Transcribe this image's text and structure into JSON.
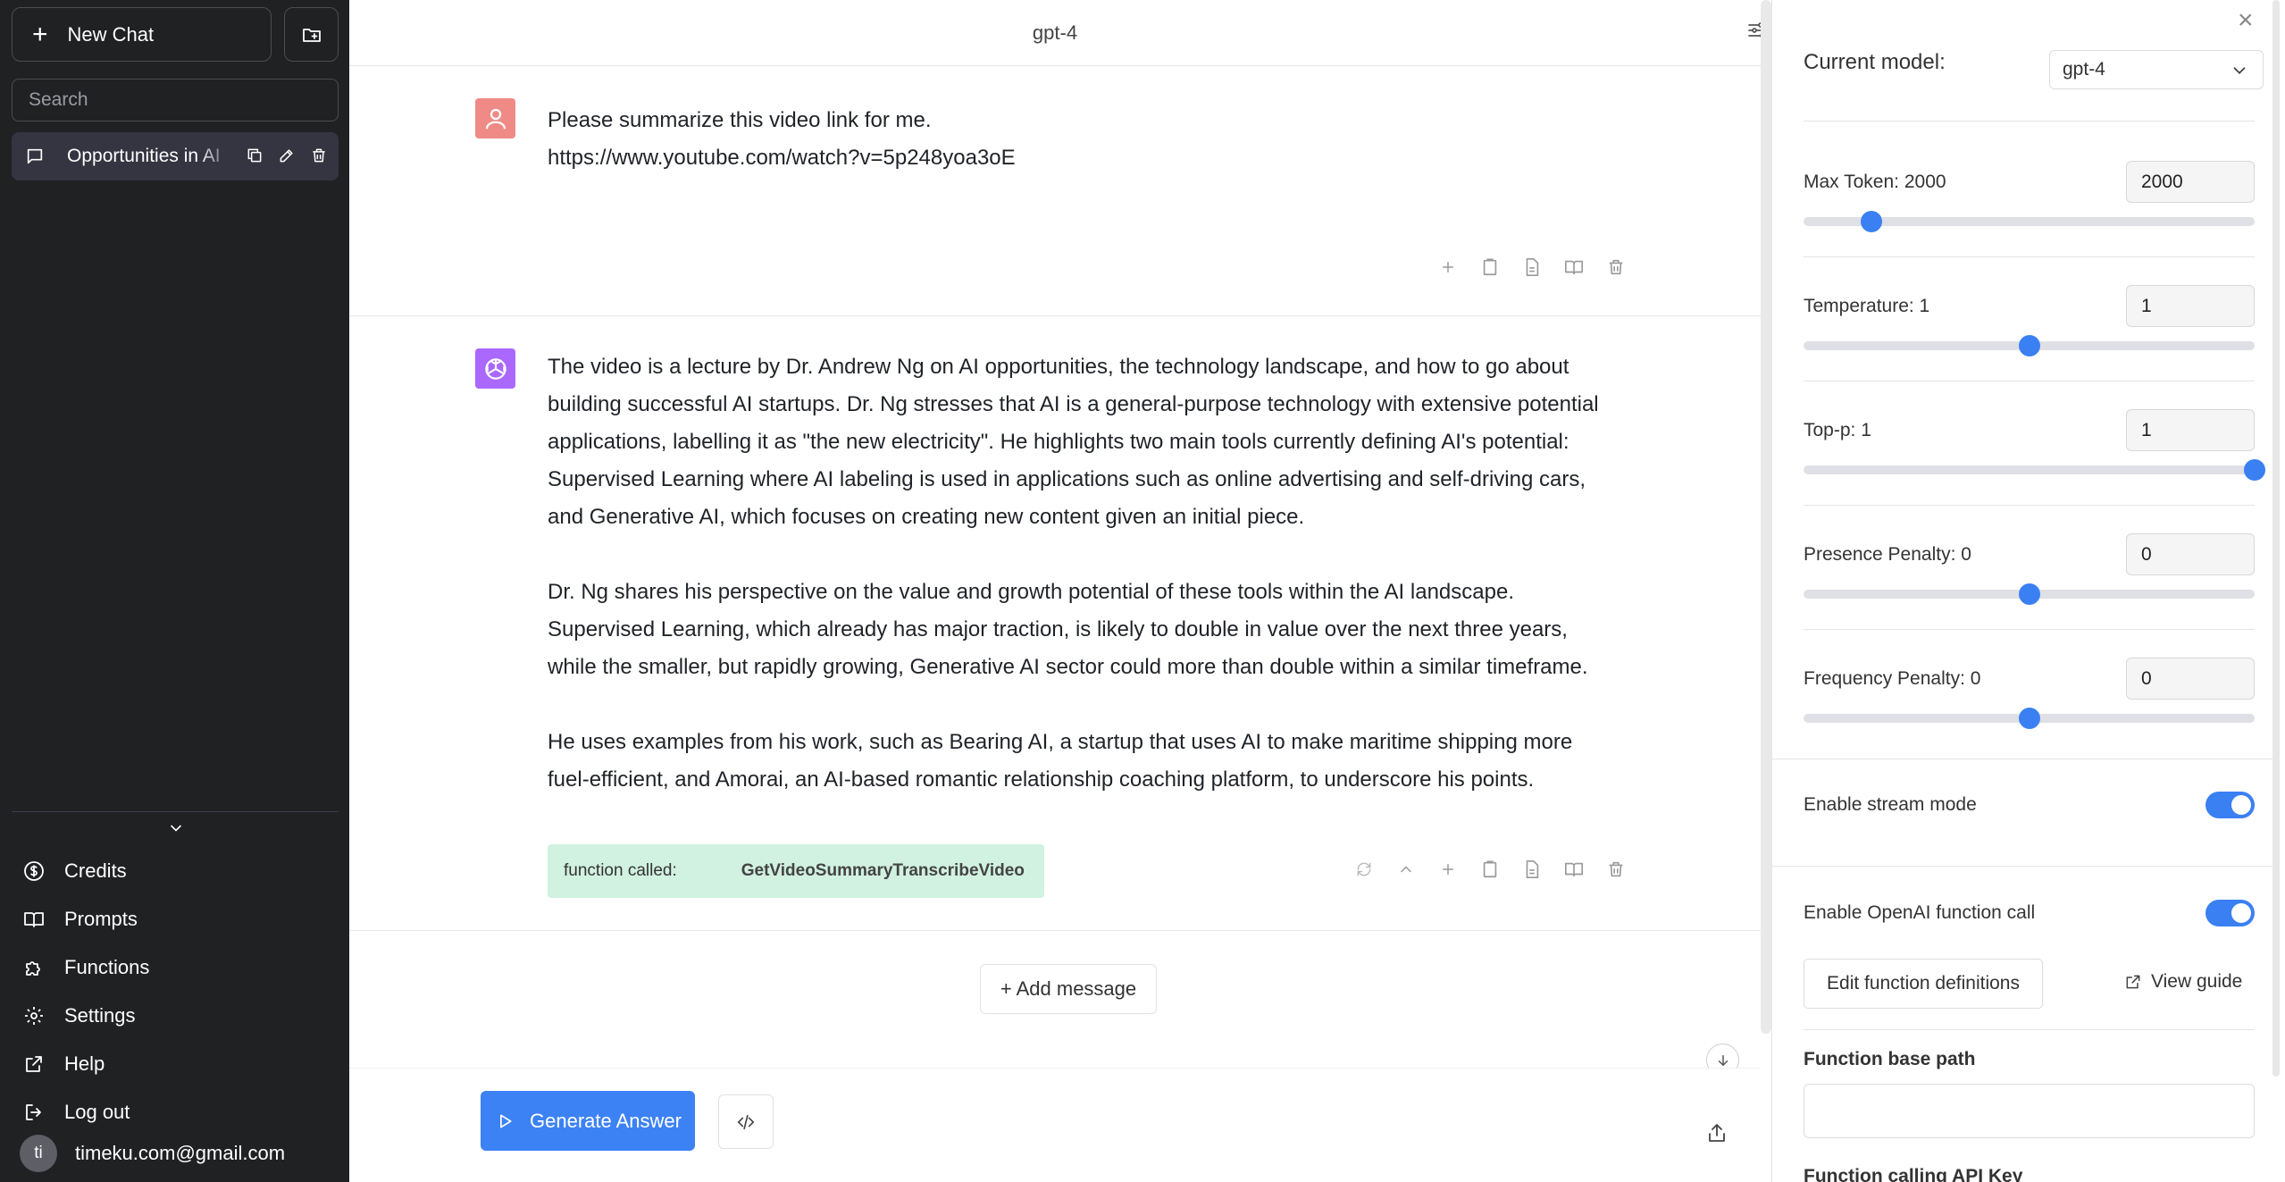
{
  "sidebar": {
    "new_chat_label": "New Chat",
    "search_placeholder": "Search",
    "chats": [
      {
        "title": "Opportunities in AI"
      }
    ],
    "menu": [
      {
        "label": "Credits",
        "icon": "dollar-circle-icon"
      },
      {
        "label": "Prompts",
        "icon": "book-open-icon"
      },
      {
        "label": "Functions",
        "icon": "puzzle-icon"
      },
      {
        "label": "Settings",
        "icon": "gear-icon"
      },
      {
        "label": "Help",
        "icon": "external-link-icon"
      },
      {
        "label": "Log out",
        "icon": "logout-icon"
      }
    ],
    "user": {
      "initials": "ti",
      "email": "timeku.com@gmail.com"
    }
  },
  "header": {
    "model_title": "gpt-4"
  },
  "messages": [
    {
      "role": "user",
      "lines": [
        "Please summarize this video link for me.",
        "https://www.youtube.com/watch?v=5p248yoa3oE"
      ]
    },
    {
      "role": "assistant",
      "paragraphs": [
        "The video is a lecture by Dr. Andrew Ng on AI opportunities, the technology landscape, and how to go about building successful AI startups. Dr. Ng stresses that AI is a general-purpose technology with extensive potential applications, labelling it as \"the new electricity\". He highlights two main tools currently defining AI's potential: Supervised Learning where AI labeling is used in applications such as online advertising and self-driving cars, and Generative AI, which focuses on creating new content given an initial piece.",
        "Dr. Ng shares his perspective on the value and growth potential of these tools within the AI landscape. Supervised Learning, which already has major traction, is likely to double in value over the next three years, while the smaller, but rapidly growing, Generative AI sector could more than double within a similar timeframe.",
        "He uses examples from his work, such as Bearing AI, a startup that uses AI to make maritime shipping more fuel-efficient, and Amorai, an AI-based romantic relationship coaching platform, to underscore his points."
      ],
      "function_call": {
        "label": "function called:",
        "name": "GetVideoSummaryTranscribeVideo"
      }
    }
  ],
  "actions": {
    "add_message": "+ Add message",
    "generate_answer": "Generate Answer"
  },
  "panel": {
    "current_model_label": "Current model:",
    "current_model_value": "gpt-4",
    "params": [
      {
        "label": "Max Token: 2000",
        "value": "2000",
        "level": 0.15
      },
      {
        "label": "Temperature: 1",
        "value": "1",
        "level": 0.5
      },
      {
        "label": "Top-p: 1",
        "value": "1",
        "level": 1.0
      },
      {
        "label": "Presence Penalty: 0",
        "value": "0",
        "level": 0.5
      },
      {
        "label": "Frequency Penalty: 0",
        "value": "0",
        "level": 0.5
      }
    ],
    "stream_mode_label": "Enable stream mode",
    "stream_mode_on": true,
    "function_call_label": "Enable OpenAI function call",
    "function_call_on": true,
    "edit_function_label": "Edit function definitions",
    "view_guide_label": "View guide",
    "function_base_path_label": "Function base path",
    "function_base_path_value": "",
    "api_key_label": "Function calling API Key"
  },
  "colors": {
    "sidebar_bg": "#202123",
    "accent_blue": "#3d82f5",
    "function_call_bg": "#d1f1e1",
    "user_avatar": "#ef8a86",
    "assistant_avatar": "#ab68ff"
  }
}
